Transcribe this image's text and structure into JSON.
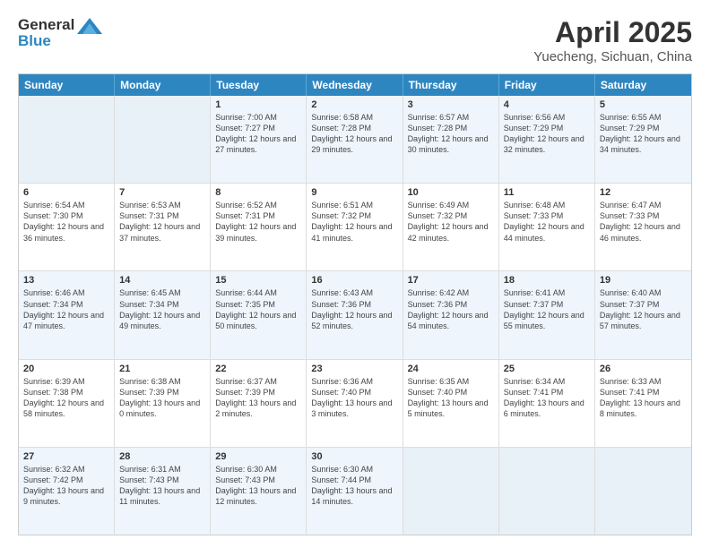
{
  "header": {
    "logo_general": "General",
    "logo_blue": "Blue",
    "title": "April 2025",
    "location": "Yuecheng, Sichuan, China"
  },
  "weekdays": [
    "Sunday",
    "Monday",
    "Tuesday",
    "Wednesday",
    "Thursday",
    "Friday",
    "Saturday"
  ],
  "rows": [
    [
      {
        "day": "",
        "sunrise": "",
        "sunset": "",
        "daylight": "",
        "empty": true
      },
      {
        "day": "",
        "sunrise": "",
        "sunset": "",
        "daylight": "",
        "empty": true
      },
      {
        "day": "1",
        "sunrise": "Sunrise: 7:00 AM",
        "sunset": "Sunset: 7:27 PM",
        "daylight": "Daylight: 12 hours and 27 minutes.",
        "empty": false
      },
      {
        "day": "2",
        "sunrise": "Sunrise: 6:58 AM",
        "sunset": "Sunset: 7:28 PM",
        "daylight": "Daylight: 12 hours and 29 minutes.",
        "empty": false
      },
      {
        "day": "3",
        "sunrise": "Sunrise: 6:57 AM",
        "sunset": "Sunset: 7:28 PM",
        "daylight": "Daylight: 12 hours and 30 minutes.",
        "empty": false
      },
      {
        "day": "4",
        "sunrise": "Sunrise: 6:56 AM",
        "sunset": "Sunset: 7:29 PM",
        "daylight": "Daylight: 12 hours and 32 minutes.",
        "empty": false
      },
      {
        "day": "5",
        "sunrise": "Sunrise: 6:55 AM",
        "sunset": "Sunset: 7:29 PM",
        "daylight": "Daylight: 12 hours and 34 minutes.",
        "empty": false
      }
    ],
    [
      {
        "day": "6",
        "sunrise": "Sunrise: 6:54 AM",
        "sunset": "Sunset: 7:30 PM",
        "daylight": "Daylight: 12 hours and 36 minutes.",
        "empty": false
      },
      {
        "day": "7",
        "sunrise": "Sunrise: 6:53 AM",
        "sunset": "Sunset: 7:31 PM",
        "daylight": "Daylight: 12 hours and 37 minutes.",
        "empty": false
      },
      {
        "day": "8",
        "sunrise": "Sunrise: 6:52 AM",
        "sunset": "Sunset: 7:31 PM",
        "daylight": "Daylight: 12 hours and 39 minutes.",
        "empty": false
      },
      {
        "day": "9",
        "sunrise": "Sunrise: 6:51 AM",
        "sunset": "Sunset: 7:32 PM",
        "daylight": "Daylight: 12 hours and 41 minutes.",
        "empty": false
      },
      {
        "day": "10",
        "sunrise": "Sunrise: 6:49 AM",
        "sunset": "Sunset: 7:32 PM",
        "daylight": "Daylight: 12 hours and 42 minutes.",
        "empty": false
      },
      {
        "day": "11",
        "sunrise": "Sunrise: 6:48 AM",
        "sunset": "Sunset: 7:33 PM",
        "daylight": "Daylight: 12 hours and 44 minutes.",
        "empty": false
      },
      {
        "day": "12",
        "sunrise": "Sunrise: 6:47 AM",
        "sunset": "Sunset: 7:33 PM",
        "daylight": "Daylight: 12 hours and 46 minutes.",
        "empty": false
      }
    ],
    [
      {
        "day": "13",
        "sunrise": "Sunrise: 6:46 AM",
        "sunset": "Sunset: 7:34 PM",
        "daylight": "Daylight: 12 hours and 47 minutes.",
        "empty": false
      },
      {
        "day": "14",
        "sunrise": "Sunrise: 6:45 AM",
        "sunset": "Sunset: 7:34 PM",
        "daylight": "Daylight: 12 hours and 49 minutes.",
        "empty": false
      },
      {
        "day": "15",
        "sunrise": "Sunrise: 6:44 AM",
        "sunset": "Sunset: 7:35 PM",
        "daylight": "Daylight: 12 hours and 50 minutes.",
        "empty": false
      },
      {
        "day": "16",
        "sunrise": "Sunrise: 6:43 AM",
        "sunset": "Sunset: 7:36 PM",
        "daylight": "Daylight: 12 hours and 52 minutes.",
        "empty": false
      },
      {
        "day": "17",
        "sunrise": "Sunrise: 6:42 AM",
        "sunset": "Sunset: 7:36 PM",
        "daylight": "Daylight: 12 hours and 54 minutes.",
        "empty": false
      },
      {
        "day": "18",
        "sunrise": "Sunrise: 6:41 AM",
        "sunset": "Sunset: 7:37 PM",
        "daylight": "Daylight: 12 hours and 55 minutes.",
        "empty": false
      },
      {
        "day": "19",
        "sunrise": "Sunrise: 6:40 AM",
        "sunset": "Sunset: 7:37 PM",
        "daylight": "Daylight: 12 hours and 57 minutes.",
        "empty": false
      }
    ],
    [
      {
        "day": "20",
        "sunrise": "Sunrise: 6:39 AM",
        "sunset": "Sunset: 7:38 PM",
        "daylight": "Daylight: 12 hours and 58 minutes.",
        "empty": false
      },
      {
        "day": "21",
        "sunrise": "Sunrise: 6:38 AM",
        "sunset": "Sunset: 7:39 PM",
        "daylight": "Daylight: 13 hours and 0 minutes.",
        "empty": false
      },
      {
        "day": "22",
        "sunrise": "Sunrise: 6:37 AM",
        "sunset": "Sunset: 7:39 PM",
        "daylight": "Daylight: 13 hours and 2 minutes.",
        "empty": false
      },
      {
        "day": "23",
        "sunrise": "Sunrise: 6:36 AM",
        "sunset": "Sunset: 7:40 PM",
        "daylight": "Daylight: 13 hours and 3 minutes.",
        "empty": false
      },
      {
        "day": "24",
        "sunrise": "Sunrise: 6:35 AM",
        "sunset": "Sunset: 7:40 PM",
        "daylight": "Daylight: 13 hours and 5 minutes.",
        "empty": false
      },
      {
        "day": "25",
        "sunrise": "Sunrise: 6:34 AM",
        "sunset": "Sunset: 7:41 PM",
        "daylight": "Daylight: 13 hours and 6 minutes.",
        "empty": false
      },
      {
        "day": "26",
        "sunrise": "Sunrise: 6:33 AM",
        "sunset": "Sunset: 7:41 PM",
        "daylight": "Daylight: 13 hours and 8 minutes.",
        "empty": false
      }
    ],
    [
      {
        "day": "27",
        "sunrise": "Sunrise: 6:32 AM",
        "sunset": "Sunset: 7:42 PM",
        "daylight": "Daylight: 13 hours and 9 minutes.",
        "empty": false
      },
      {
        "day": "28",
        "sunrise": "Sunrise: 6:31 AM",
        "sunset": "Sunset: 7:43 PM",
        "daylight": "Daylight: 13 hours and 11 minutes.",
        "empty": false
      },
      {
        "day": "29",
        "sunrise": "Sunrise: 6:30 AM",
        "sunset": "Sunset: 7:43 PM",
        "daylight": "Daylight: 13 hours and 12 minutes.",
        "empty": false
      },
      {
        "day": "30",
        "sunrise": "Sunrise: 6:30 AM",
        "sunset": "Sunset: 7:44 PM",
        "daylight": "Daylight: 13 hours and 14 minutes.",
        "empty": false
      },
      {
        "day": "",
        "sunrise": "",
        "sunset": "",
        "daylight": "",
        "empty": true
      },
      {
        "day": "",
        "sunrise": "",
        "sunset": "",
        "daylight": "",
        "empty": true
      },
      {
        "day": "",
        "sunrise": "",
        "sunset": "",
        "daylight": "",
        "empty": true
      }
    ]
  ],
  "alt_rows": [
    0,
    2,
    4
  ]
}
